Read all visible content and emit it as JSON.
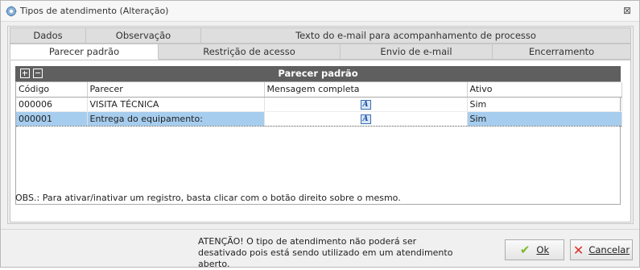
{
  "window": {
    "title": "Tipos de atendimento (Alteração)",
    "close_glyph": "⊠"
  },
  "tabs_row1": [
    {
      "label": "Dados"
    },
    {
      "label": "Observação"
    },
    {
      "label": "Texto do e-mail para acompanhamento de processo"
    }
  ],
  "tabs_row2": [
    {
      "label": "Parecer padrão",
      "active": true
    },
    {
      "label": "Restrição de acesso"
    },
    {
      "label": "Envio de e-mail"
    },
    {
      "label": "Encerramento"
    }
  ],
  "grid": {
    "title": "Parecer padrão",
    "columns": [
      "Código",
      "Parecer",
      "Mensagem completa",
      "Ativo"
    ],
    "rows": [
      {
        "codigo": "000006",
        "parecer": "VISITA TÉCNICA",
        "ativo": "Sim",
        "selected": false
      },
      {
        "codigo": "000001",
        "parecer": "Entrega do equipamento:",
        "ativo": "Sim",
        "selected": true
      }
    ],
    "message_icon_glyph": "A"
  },
  "obs_text": "OBS.: Para ativar/inativar um registro, basta clicar com o botão direito sobre o mesmo.",
  "footer": {
    "warning_line1": "ATENÇÃO! O tipo de atendimento não poderá ser",
    "warning_line2": "desativado pois está sendo utilizado em  um atendimento aberto.",
    "ok_label": "Ok",
    "cancel_label": "Cancelar"
  },
  "colors": {
    "selected_row": "#a6cdee",
    "grid_header": "#5f5f5f",
    "ok_check": "#7cb928",
    "cancel_x": "#d8322a"
  },
  "icons": {
    "app": "app-gear-icon",
    "close": "close-icon",
    "expand": "expand-plus-icon",
    "collapse": "collapse-minus-icon",
    "message": "rich-text-icon",
    "ok": "check-icon",
    "cancel": "x-icon"
  }
}
